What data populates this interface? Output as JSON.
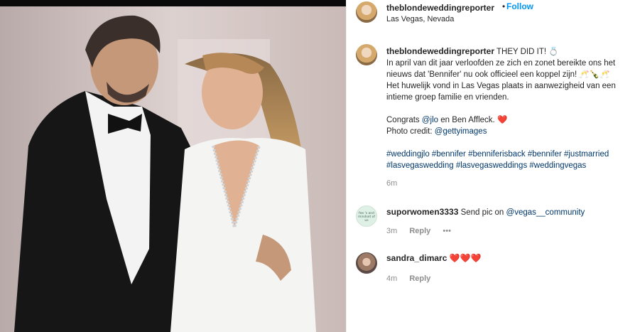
{
  "post": {
    "username": "theblondeweddingreporter",
    "dot": "•",
    "follow_label": "Follow",
    "location": "Las Vegas, Nevada"
  },
  "caption": {
    "username": "theblondeweddingreporter",
    "headline": "THEY DID IT! 💍",
    "line1": "In april van dit jaar verloofden ze zich en zonet bereikte ons het nieuws dat 'Bennifer' nu ook officieel een koppel zijn! 🥂🍾🥂",
    "line2": "Het huwelijk vond in Las Vegas plaats in aanwezigheid van een intieme groep familie en vrienden.",
    "congrats_prefix": "Congrats ",
    "congrats_mention": "@jlo",
    "congrats_suffix": " en Ben Affleck. ❤️",
    "credit_prefix": "Photo credit: ",
    "credit_mention": "@gettyimages",
    "hashtags": "#weddingjlo #bennifer #benniferisback #bennifer #justmarried #lasvegaswedding #lasvegasweddings #weddingvegas",
    "time": "6m"
  },
  "comments": [
    {
      "username": "suporwomen3333",
      "text": "Send pic on ",
      "mention": "@vegas__community",
      "time": "3m",
      "reply_label": "Reply",
      "more": "•••",
      "avatar_text": "fee 's and mindset of us"
    },
    {
      "username": "sandra_dimarc",
      "text": "❤️❤️❤️",
      "time": "4m",
      "reply_label": "Reply"
    }
  ],
  "colors": {
    "link": "#00376b",
    "follow": "#0095f6",
    "meta": "#8e8e8e",
    "heart": "#e0102b"
  }
}
